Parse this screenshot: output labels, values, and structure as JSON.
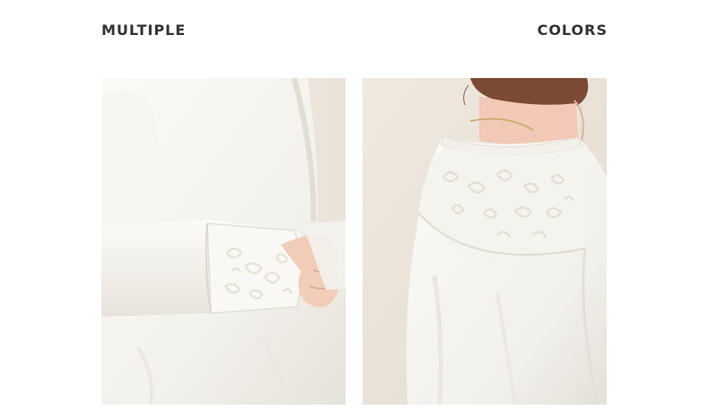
{
  "headings": {
    "left": "MULTIPLE",
    "right": "COLORS"
  },
  "photos": [
    {
      "subject": "sleeve-cuff-detail"
    },
    {
      "subject": "shoulder-detail"
    }
  ],
  "colors": {
    "background": "#ffffff",
    "heading_text": "#333333",
    "garment_white": "#f6f4ef",
    "backdrop_cream": "#ece6dc",
    "skin": "#f1c9b6",
    "hair": "#7a4a35"
  }
}
